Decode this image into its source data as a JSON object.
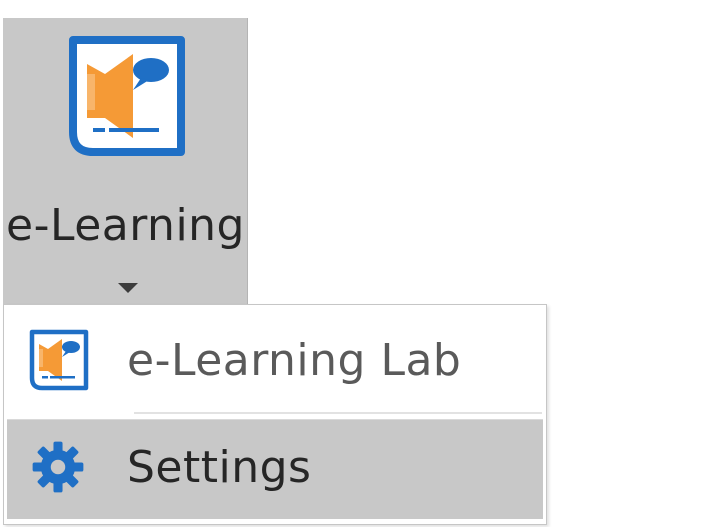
{
  "ribbon": {
    "button_label": "e-Learning",
    "icon": "e-learning-lab-icon",
    "dropdown_icon": "chevron-down-icon"
  },
  "menu": {
    "items": [
      {
        "label": "e-Learning Lab",
        "icon": "e-learning-lab-icon"
      },
      {
        "label": "Settings",
        "icon": "gear-icon"
      }
    ]
  },
  "colors": {
    "ribbon_hover_bg": "#c8c8c8",
    "icon_blue": "#1f6fc5",
    "icon_orange": "#f59a36",
    "menu_hover_bg": "#c8c8c8"
  }
}
